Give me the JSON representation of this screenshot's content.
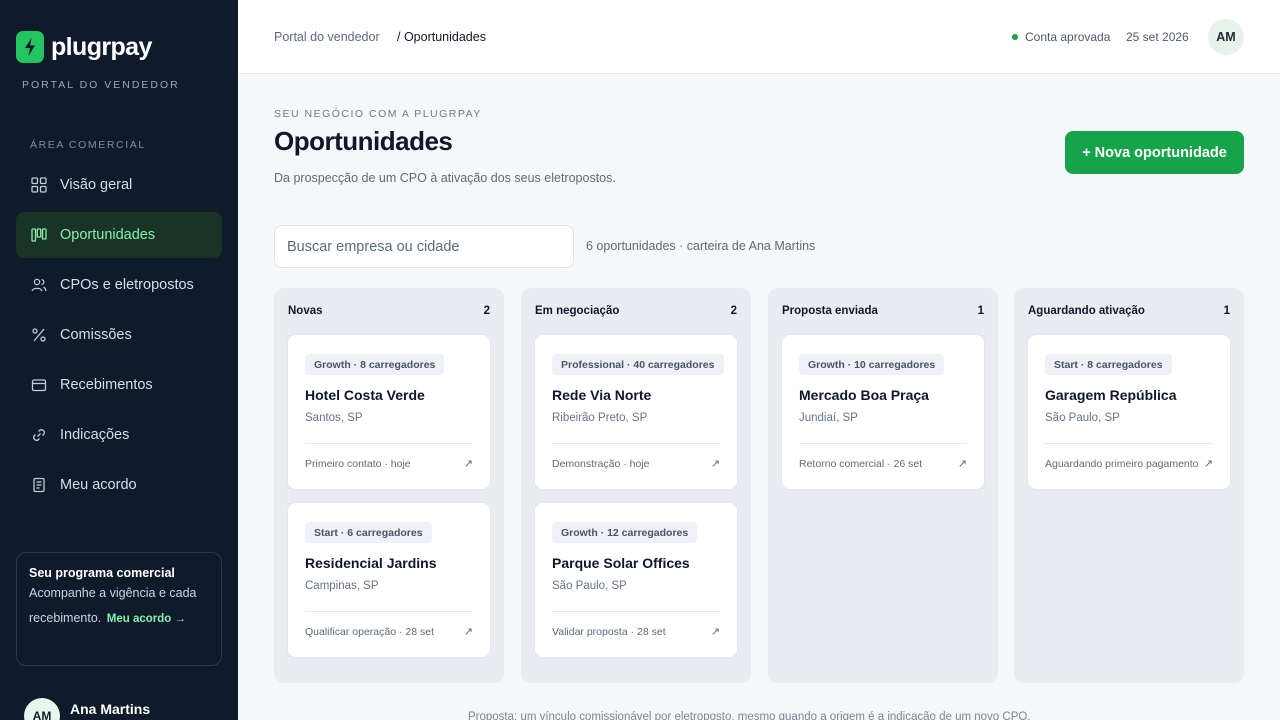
{
  "brand": {
    "name": "plugrpay",
    "subtitle": "PORTAL DO VENDEDOR",
    "icon": "bolt-icon",
    "accent": "#22c55e"
  },
  "sidebar": {
    "section_label": "ÁREA COMERCIAL",
    "items": [
      {
        "label": "Visão geral",
        "icon": "grid-icon",
        "active": false
      },
      {
        "label": "Oportunidades",
        "icon": "kanban-icon",
        "active": true
      },
      {
        "label": "CPOs e eletropostos",
        "icon": "users-icon",
        "active": false
      },
      {
        "label": "Comissões",
        "icon": "percent-icon",
        "active": false
      },
      {
        "label": "Recebimentos",
        "icon": "wallet-icon",
        "active": false
      },
      {
        "label": "Indicações",
        "icon": "link-icon",
        "active": false
      },
      {
        "label": "Meu acordo",
        "icon": "document-icon",
        "active": false
      }
    ],
    "promo": {
      "title": "Seu programa comercial",
      "text_1": "Acompanhe a vigência e cada",
      "text_2": "recebimento.",
      "link": "Meu acordo →"
    },
    "user": {
      "initials": "AM",
      "name": "Ana Martins"
    }
  },
  "header": {
    "breadcrumb_root": "Portal do vendedor",
    "breadcrumb_current": "/ Oportunidades",
    "status": "Conta aprovada",
    "status_color": "#16a34a",
    "date": "25 set 2026",
    "avatar_initials": "AM"
  },
  "main": {
    "eyebrow": "SEU NEGÓCIO COM A PLUGRPAY",
    "title": "Oportunidades",
    "subtitle": "Da prospecção de um CPO à ativação dos seus eletropostos.",
    "new_button": "+ Nova oportunidade",
    "search_placeholder": "Buscar empresa ou cidade",
    "search_value": "",
    "count_text": "6 oportunidades · carteira de Ana Martins",
    "footnote": "Proposta: um vínculo comissionável por eletroposto, mesmo quando a origem é a indicação de um novo CPO."
  },
  "columns": [
    {
      "title": "Novas",
      "count": "2",
      "cards": [
        {
          "badge": "Growth · 8 carregadores",
          "name": "Hotel Costa Verde",
          "city": "Santos, SP",
          "footer": "Primeiro contato · hoje",
          "arrow": "↗"
        },
        {
          "badge": "Start · 6 carregadores",
          "name": "Residencial Jardins",
          "city": "Campinas, SP",
          "footer": "Qualificar operação · 28 set",
          "arrow": "↗"
        }
      ]
    },
    {
      "title": "Em negociação",
      "count": "2",
      "cards": [
        {
          "badge": "Professional · 40 carregadores",
          "name": "Rede Via Norte",
          "city": "Ribeirão Preto, SP",
          "footer": "Demonstração · hoje",
          "arrow": "↗"
        },
        {
          "badge": "Growth · 12 carregadores",
          "name": "Parque Solar Offices",
          "city": "São Paulo, SP",
          "footer": "Validar proposta · 28 set",
          "arrow": "↗"
        }
      ]
    },
    {
      "title": "Proposta enviada",
      "count": "1",
      "cards": [
        {
          "badge": "Growth · 10 carregadores",
          "name": "Mercado Boa Praça",
          "city": "Jundiaí, SP",
          "footer": "Retorno comercial · 26 set",
          "arrow": "↗"
        }
      ]
    },
    {
      "title": "Aguardando ativação",
      "count": "1",
      "cards": [
        {
          "badge": "Start · 8 carregadores",
          "name": "Garagem República",
          "city": "São Paulo, SP",
          "footer": "Aguardando primeiro pagamento",
          "arrow": "↗"
        }
      ]
    }
  ]
}
